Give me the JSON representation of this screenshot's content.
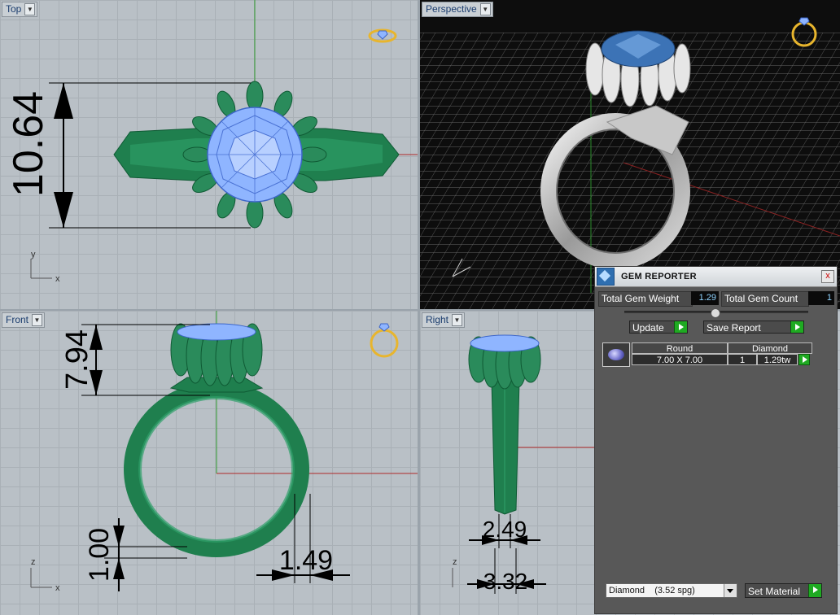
{
  "viewports": {
    "top": {
      "label": "Top"
    },
    "perspective": {
      "label": "Perspective"
    },
    "front": {
      "label": "Front"
    },
    "right": {
      "label": "Right"
    }
  },
  "dimensions": {
    "top_height": "10.64",
    "front_setting_height": "7.94",
    "front_band_thickness": "1.00",
    "front_band_width": "1.49",
    "right_band_top": "2.49",
    "right_band_bottom": "3.32"
  },
  "axes": {
    "x": "x",
    "y": "y",
    "z": "z"
  },
  "gem_reporter": {
    "title": "GEM REPORTER",
    "close_label": "x",
    "total_weight_label": "Total Gem Weight",
    "total_weight_value": "1.29",
    "total_count_label": "Total Gem Count",
    "total_count_value": "1",
    "update_label": "Update",
    "save_report_label": "Save Report",
    "table": {
      "shape": "Round",
      "size": "7.00 X 7.00",
      "material": "Diamond",
      "count": "1",
      "weight": "1.29tw"
    },
    "material_select": "Diamond    (3.52 spg)",
    "set_material_label": "Set Material"
  },
  "colors": {
    "viewport_bg": "#b9c0c6",
    "metal_green": "#2a8b5b",
    "gem_blue": "#8fb5ff",
    "perspective_bg": "#0d0d0d",
    "panel_bg": "#585858",
    "accent_green": "#1faa22"
  }
}
